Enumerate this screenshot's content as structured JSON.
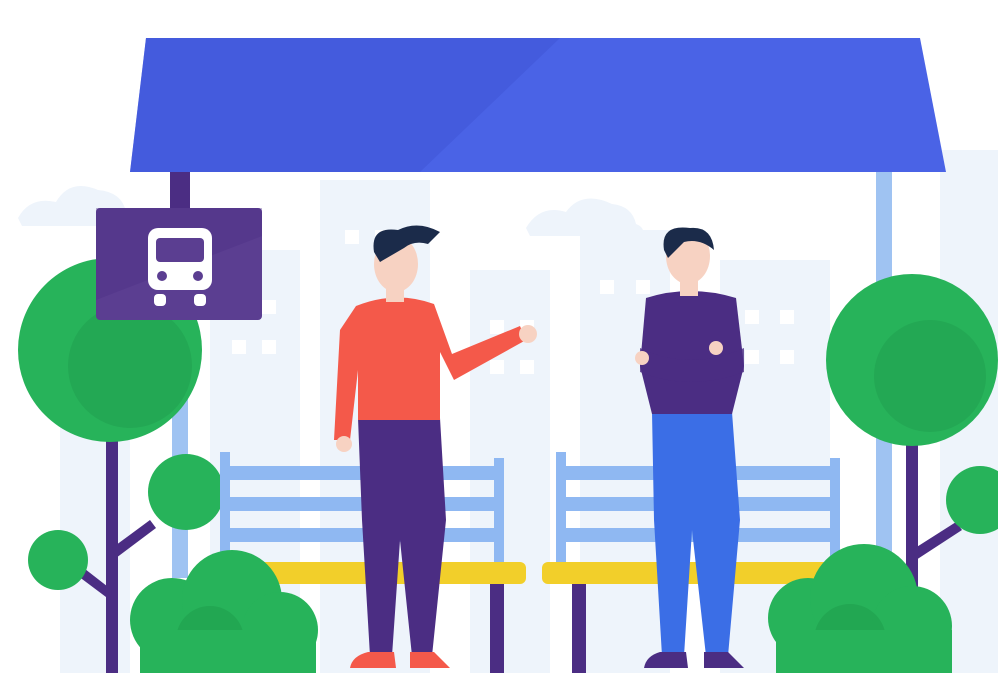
{
  "scene": {
    "subject": "bus-stop",
    "sign_icon": "bus-icon",
    "colors": {
      "background": "#ffffff",
      "city_silhouette": "#eef4fb",
      "city_windows": "#ffffff",
      "roof": "#4a63e6",
      "roof_shade": "#3f56d6",
      "pole": "#9fc3f2",
      "sign_post": "#4b2d83",
      "sign_board": "#5b3e91",
      "sign_icon": "#ffffff",
      "bench_back": "#8fb8f2",
      "bench_seat": "#f2cf2a",
      "bench_leg": "#4b2d83",
      "tree_crown": "#27b35a",
      "tree_crown_dark": "#1f9e4d",
      "tree_trunk": "#4b2d83",
      "bush": "#27b35a",
      "bush_dark": "#1f9e4d",
      "skin": "#f7d2c2",
      "hair": "#1b2b4a",
      "man_left_shirt": "#f4594a",
      "man_left_pants": "#4b2d83",
      "man_left_shoes": "#f4594a",
      "man_right_shirt": "#4b2d83",
      "man_right_pants": "#3b6ee6",
      "man_right_shoes": "#4b2d83"
    }
  }
}
